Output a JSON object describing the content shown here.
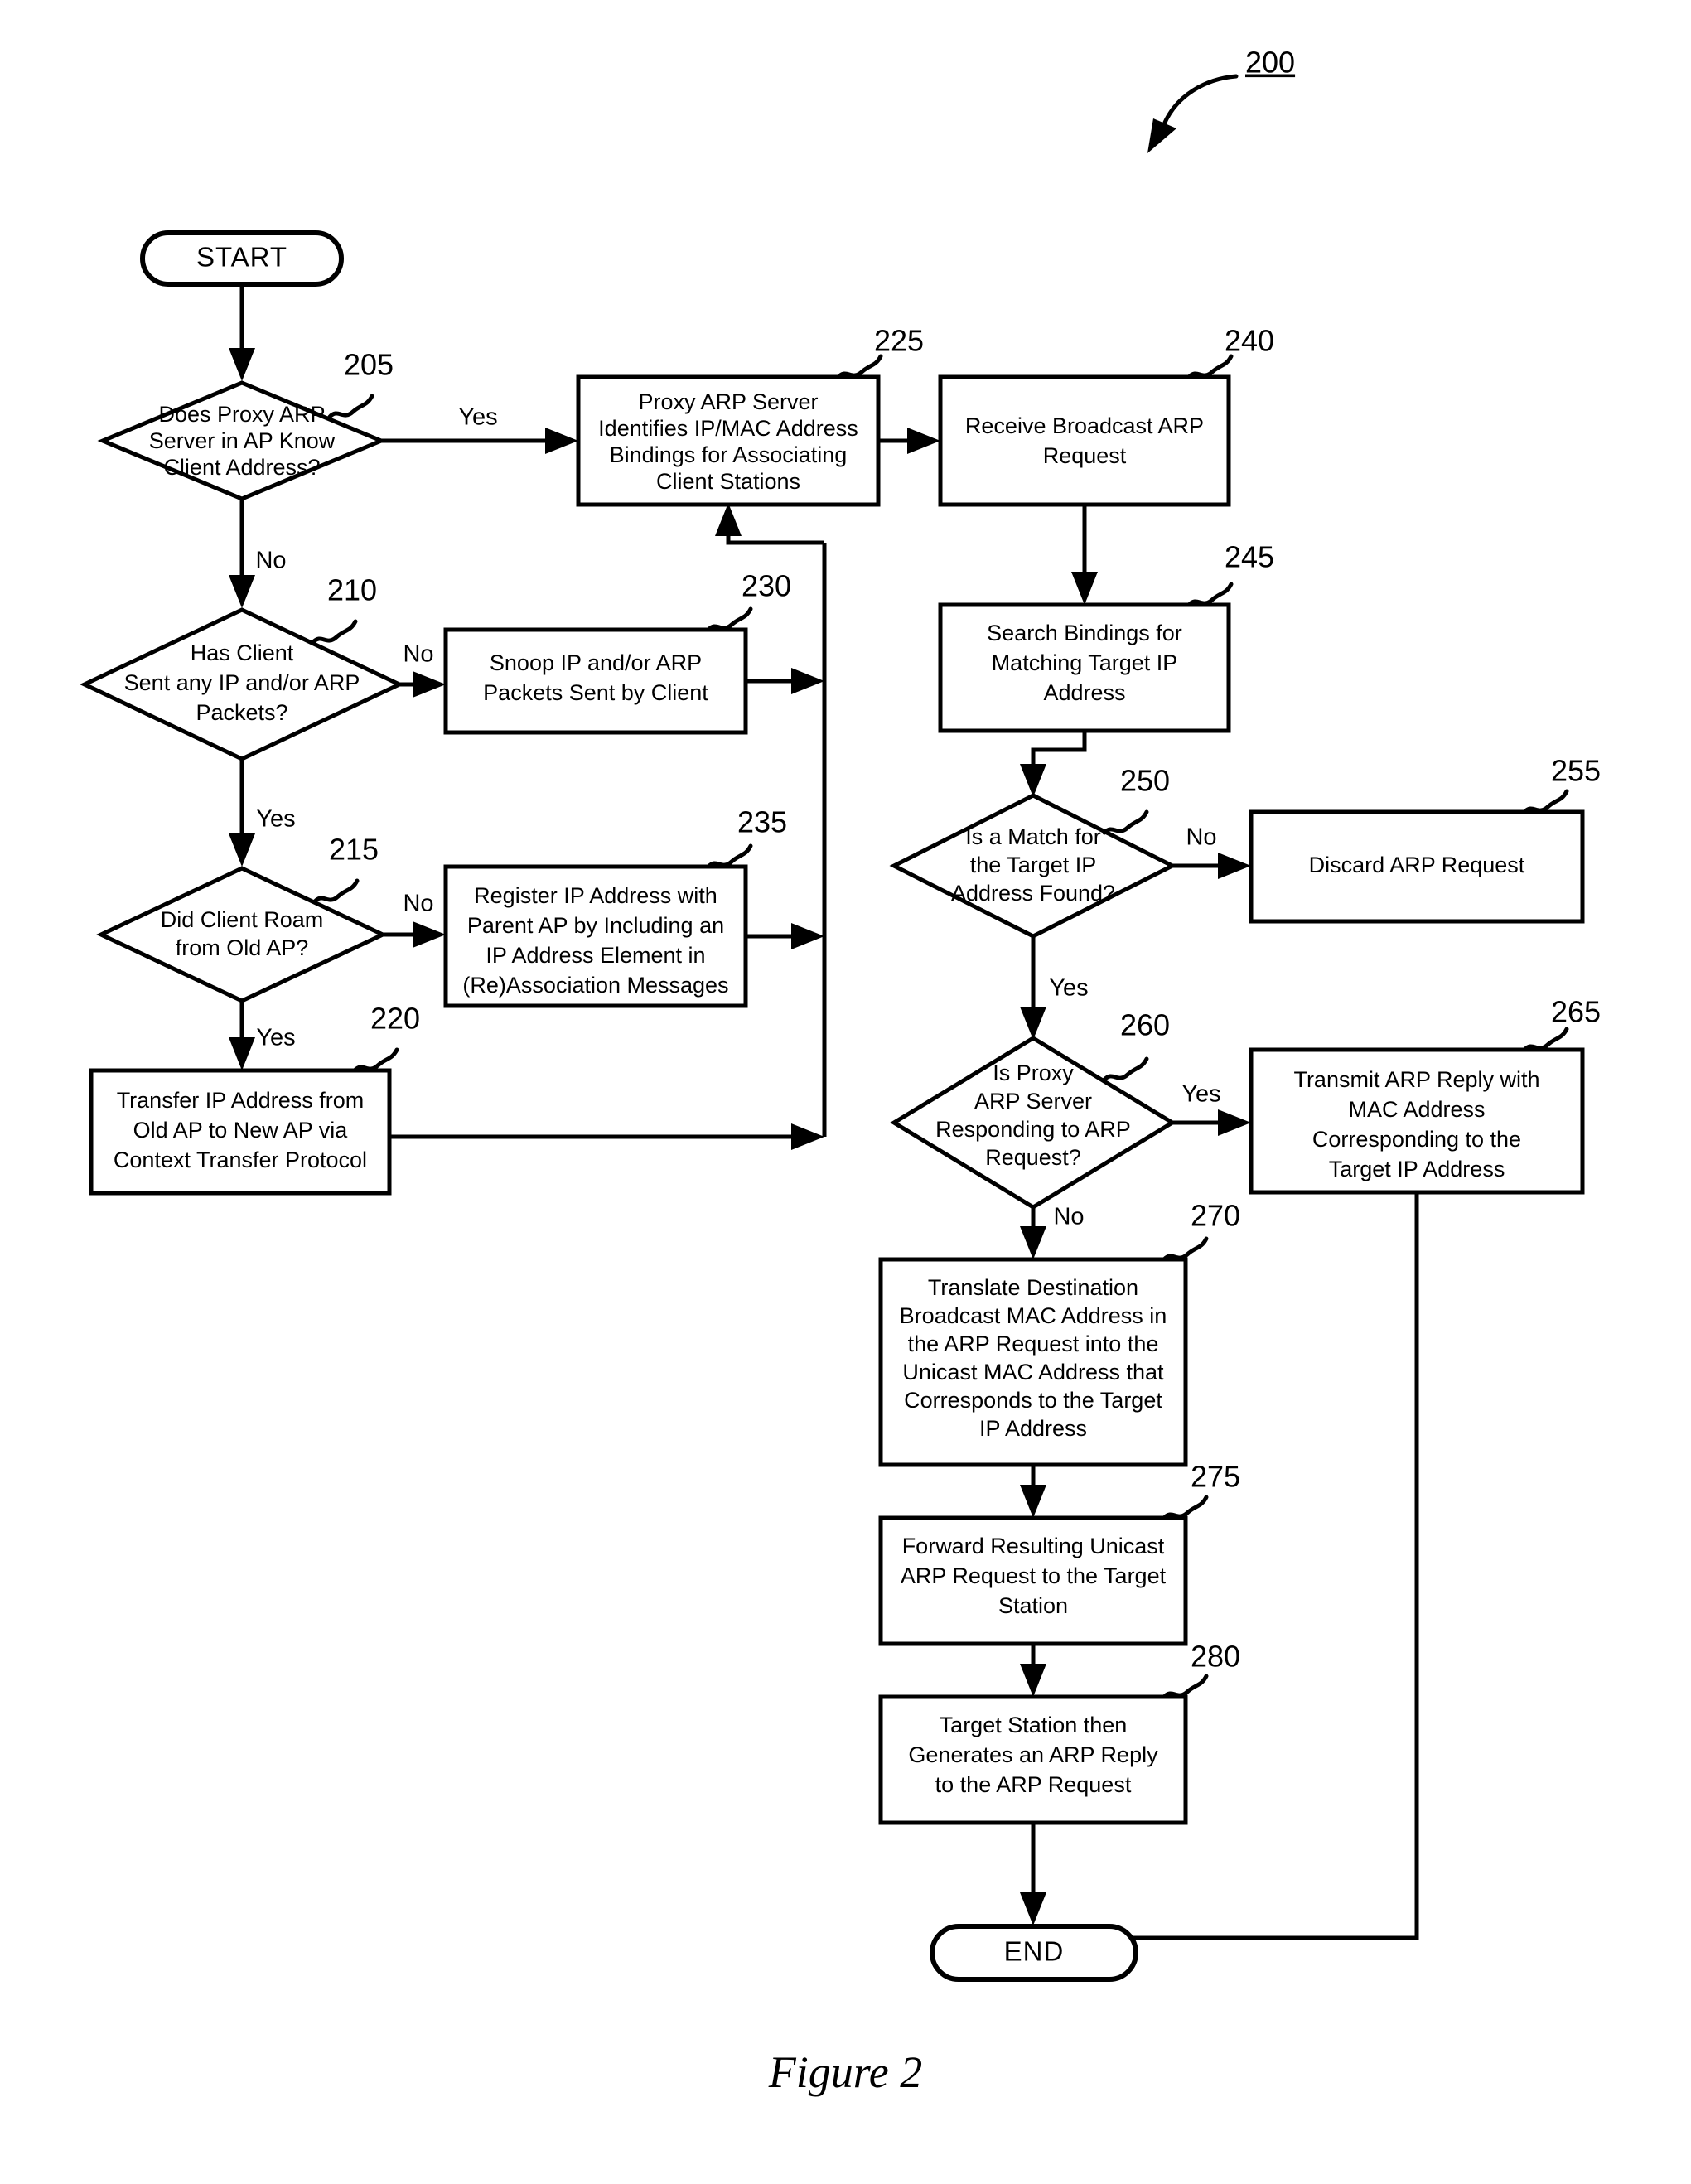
{
  "figure": {
    "caption": "Figure 2",
    "reference_number": "200"
  },
  "terminators": {
    "start": "START",
    "end": "END"
  },
  "nodes": [
    {
      "id": "205",
      "ref": "205",
      "type": "decision",
      "lines": [
        "Does Proxy ARP",
        "Server in AP Know",
        "Client Address?"
      ]
    },
    {
      "id": "210",
      "ref": "210",
      "type": "decision",
      "lines": [
        "Has Client",
        "Sent any IP and/or ARP",
        "Packets?"
      ]
    },
    {
      "id": "215",
      "ref": "215",
      "type": "decision",
      "lines": [
        "Did Client Roam",
        "from Old AP?"
      ]
    },
    {
      "id": "220",
      "ref": "220",
      "type": "process",
      "lines": [
        "Transfer IP Address from",
        "Old AP to New AP via",
        "Context Transfer Protocol"
      ]
    },
    {
      "id": "225",
      "ref": "225",
      "type": "process",
      "lines": [
        "Proxy ARP Server",
        "Identifies IP/MAC Address",
        "Bindings for Associating",
        "Client Stations"
      ]
    },
    {
      "id": "230",
      "ref": "230",
      "type": "process",
      "lines": [
        "Snoop IP and/or ARP",
        "Packets Sent by Client"
      ]
    },
    {
      "id": "235",
      "ref": "235",
      "type": "process",
      "lines": [
        "Register IP Address with",
        "Parent AP by Including an",
        "IP Address Element in",
        "(Re)Association Messages"
      ]
    },
    {
      "id": "240",
      "ref": "240",
      "type": "process",
      "lines": [
        "Receive Broadcast ARP",
        "Request"
      ]
    },
    {
      "id": "245",
      "ref": "245",
      "type": "process",
      "lines": [
        "Search Bindings for",
        "Matching Target IP",
        "Address"
      ]
    },
    {
      "id": "250",
      "ref": "250",
      "type": "decision",
      "lines": [
        "Is a Match for",
        "the Target IP",
        "Address Found?"
      ]
    },
    {
      "id": "255",
      "ref": "255",
      "type": "process",
      "lines": [
        "Discard ARP Request"
      ]
    },
    {
      "id": "260",
      "ref": "260",
      "type": "decision",
      "lines": [
        "Is Proxy",
        "ARP Server",
        "Responding to ARP",
        "Request?"
      ]
    },
    {
      "id": "265",
      "ref": "265",
      "type": "process",
      "lines": [
        "Transmit ARP Reply with",
        "MAC Address",
        "Corresponding to the",
        "Target IP Address"
      ]
    },
    {
      "id": "270",
      "ref": "270",
      "type": "process",
      "lines": [
        "Translate Destination",
        "Broadcast MAC Address in",
        "the ARP Request into the",
        "Unicast MAC Address that",
        "Corresponds to the Target",
        "IP Address"
      ]
    },
    {
      "id": "275",
      "ref": "275",
      "type": "process",
      "lines": [
        "Forward Resulting Unicast",
        "ARP Request to the Target",
        "Station"
      ]
    },
    {
      "id": "280",
      "ref": "280",
      "type": "process",
      "lines": [
        "Target Station then",
        "Generates an ARP Reply",
        "to the ARP Request"
      ]
    }
  ],
  "edge_labels": {
    "d205_yes": "Yes",
    "d205_no": "No",
    "d210_no": "No",
    "d210_yes": "Yes",
    "d215_no": "No",
    "d215_yes": "Yes",
    "d250_no": "No",
    "d250_yes": "Yes",
    "d260_yes": "Yes",
    "d260_no": "No"
  },
  "colors": {
    "ink": "#000000",
    "paper": "#ffffff"
  }
}
